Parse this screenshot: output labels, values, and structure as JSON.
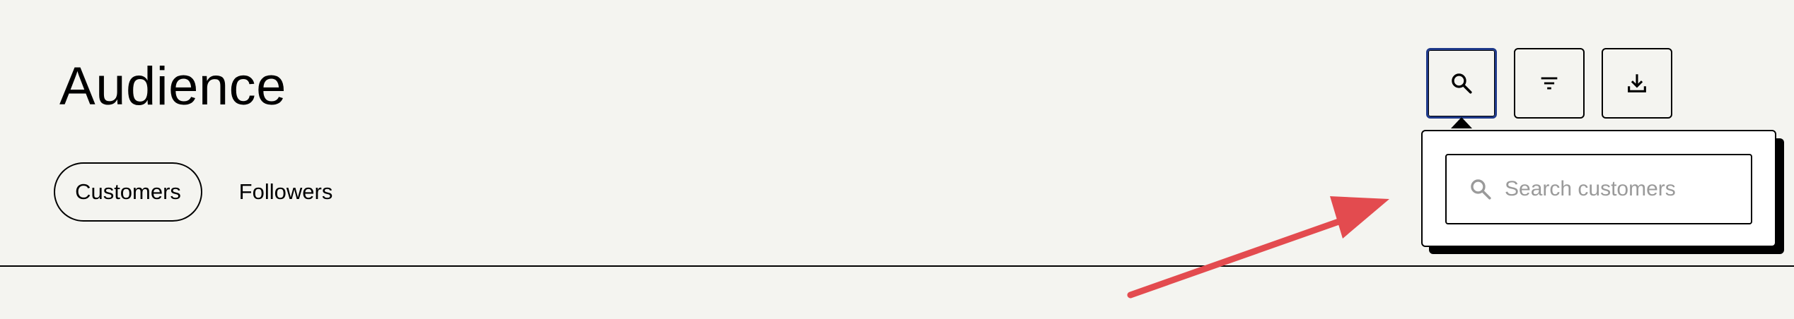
{
  "page": {
    "title": "Audience"
  },
  "tabs": [
    {
      "label": "Customers",
      "active": true
    },
    {
      "label": "Followers",
      "active": false
    }
  ],
  "toolbar": {
    "buttons": [
      {
        "icon": "search-icon",
        "active": true
      },
      {
        "icon": "filter-icon",
        "active": false
      },
      {
        "icon": "download-icon",
        "active": false
      }
    ]
  },
  "search_popover": {
    "placeholder": "Search customers",
    "value": "",
    "icon": "search-icon"
  },
  "annotation": {
    "color": "#e34b4f",
    "focus_ring_color": "#1f3a8a"
  }
}
